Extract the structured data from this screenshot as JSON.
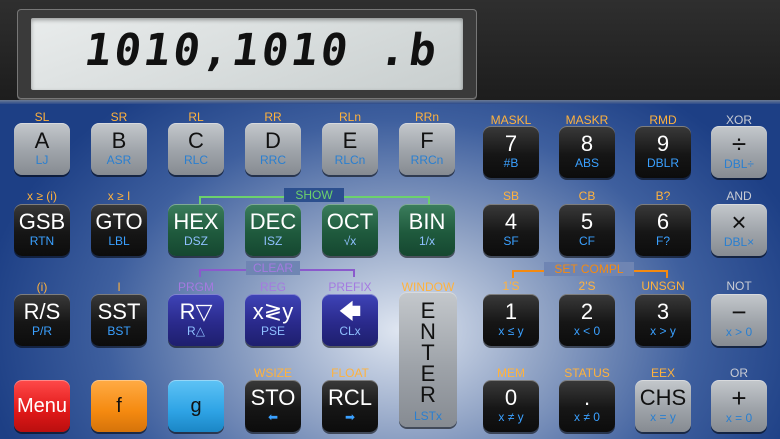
{
  "display": {
    "text": "1010,1010 .b"
  },
  "groups": {
    "show": "SHOW",
    "clear": "CLEAR",
    "set_compl": "SET COMPL"
  },
  "colors": {
    "accent_orange": "#f58a10",
    "show_green": "#6cd26c",
    "clear_purple": "#8a5acc",
    "compl_orange": "#f58a10"
  },
  "row1": [
    {
      "above": "SL",
      "main": "A",
      "sub": "LJ"
    },
    {
      "above": "SR",
      "main": "B",
      "sub": "ASR"
    },
    {
      "above": "RL",
      "main": "C",
      "sub": "RLC"
    },
    {
      "above": "RR",
      "main": "D",
      "sub": "RRC"
    },
    {
      "above": "RLn",
      "main": "E",
      "sub": "RLCn"
    },
    {
      "above": "RRn",
      "main": "F",
      "sub": "RRCn"
    },
    {
      "above": "MASKL",
      "main": "7",
      "sub": "#B"
    },
    {
      "above": "MASKR",
      "main": "8",
      "sub": "ABS"
    },
    {
      "above": "RMD",
      "main": "9",
      "sub": "DBLR"
    },
    {
      "above": "XOR",
      "main": "÷",
      "sub": "DBL÷"
    }
  ],
  "row2": [
    {
      "above": "x ≥ (i)",
      "main": "GSB",
      "sub": "RTN"
    },
    {
      "above": "x ≥ I",
      "main": "GTO",
      "sub": "LBL"
    },
    {
      "above": "",
      "main": "HEX",
      "sub": "DSZ"
    },
    {
      "above": "",
      "main": "DEC",
      "sub": "ISZ"
    },
    {
      "above": "",
      "main": "OCT",
      "sub": "√x"
    },
    {
      "above": "",
      "main": "BIN",
      "sub": "1/x"
    },
    {
      "above": "SB",
      "main": "4",
      "sub": "SF"
    },
    {
      "above": "CB",
      "main": "5",
      "sub": "CF"
    },
    {
      "above": "B?",
      "main": "6",
      "sub": "F?"
    },
    {
      "above": "AND",
      "main": "×",
      "sub": "DBL×"
    }
  ],
  "row3": [
    {
      "above": "(i)",
      "main": "R/S",
      "sub": "P/R"
    },
    {
      "above": "I",
      "main": "SST",
      "sub": "BST"
    },
    {
      "above": "PRGM",
      "main": "R▽",
      "sub": "R△"
    },
    {
      "above": "REG",
      "main": "x≷y",
      "sub": "PSE"
    },
    {
      "above": "PREFIX",
      "main": "🡄",
      "sub": "CLx"
    },
    {
      "above": "WINDOW",
      "main": "ENTER",
      "sub": "LSTx"
    },
    {
      "above": "1'S",
      "main": "1",
      "sub": "x ≤ y"
    },
    {
      "above": "2'S",
      "main": "2",
      "sub": "x < 0"
    },
    {
      "above": "UNSGN",
      "main": "3",
      "sub": "x > y"
    },
    {
      "above": "NOT",
      "main": "−",
      "sub": "x > 0"
    }
  ],
  "row4": [
    {
      "above": "",
      "main": "Menu",
      "sub": ""
    },
    {
      "above": "",
      "main": "f",
      "sub": ""
    },
    {
      "above": "",
      "main": "g",
      "sub": ""
    },
    {
      "above": "WSIZE",
      "main": "STO",
      "sub": "⬅"
    },
    {
      "above": "FLOAT",
      "main": "RCL",
      "sub": "➡"
    },
    {
      "above": "MEM",
      "main": "0",
      "sub": "x ≠ y"
    },
    {
      "above": "STATUS",
      "main": ".",
      "sub": "x ≠ 0"
    },
    {
      "above": "EEX",
      "main": "CHS",
      "sub": "x = y"
    },
    {
      "above": "OR",
      "main": "+",
      "sub": "x = 0"
    }
  ]
}
